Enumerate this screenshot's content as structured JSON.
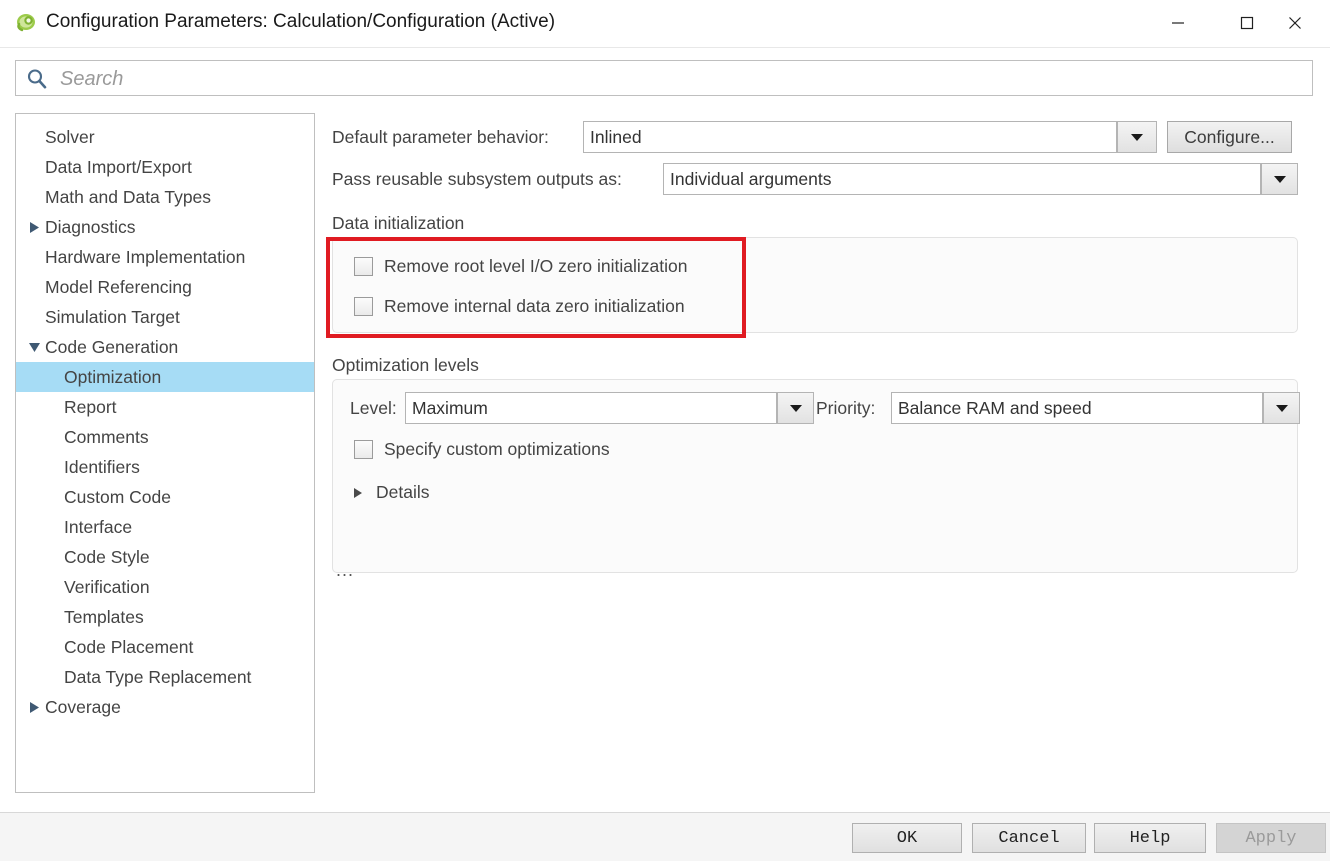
{
  "window": {
    "title": "Configuration Parameters: Calculation/Configuration (Active)",
    "app_icon": "simulink-icon",
    "minimize_label": "–",
    "maximize_label": "□",
    "close_label": "✕"
  },
  "search": {
    "placeholder": "Search",
    "value": "",
    "icon": "search-icon"
  },
  "sidebar": {
    "items": [
      {
        "label": "Solver",
        "depth": 0,
        "expander": "none",
        "selected": false
      },
      {
        "label": "Data Import/Export",
        "depth": 0,
        "expander": "none",
        "selected": false
      },
      {
        "label": "Math and Data Types",
        "depth": 0,
        "expander": "none",
        "selected": false
      },
      {
        "label": "Diagnostics",
        "depth": 0,
        "expander": "collapsed",
        "selected": false
      },
      {
        "label": "Hardware Implementation",
        "depth": 0,
        "expander": "none",
        "selected": false
      },
      {
        "label": "Model Referencing",
        "depth": 0,
        "expander": "none",
        "selected": false
      },
      {
        "label": "Simulation Target",
        "depth": 0,
        "expander": "none",
        "selected": false
      },
      {
        "label": "Code Generation",
        "depth": 0,
        "expander": "expanded",
        "selected": false
      },
      {
        "label": "Optimization",
        "depth": 1,
        "expander": "none",
        "selected": true
      },
      {
        "label": "Report",
        "depth": 1,
        "expander": "none",
        "selected": false
      },
      {
        "label": "Comments",
        "depth": 1,
        "expander": "none",
        "selected": false
      },
      {
        "label": "Identifiers",
        "depth": 1,
        "expander": "none",
        "selected": false
      },
      {
        "label": "Custom Code",
        "depth": 1,
        "expander": "none",
        "selected": false
      },
      {
        "label": "Interface",
        "depth": 1,
        "expander": "none",
        "selected": false
      },
      {
        "label": "Code Style",
        "depth": 1,
        "expander": "none",
        "selected": false
      },
      {
        "label": "Verification",
        "depth": 1,
        "expander": "none",
        "selected": false
      },
      {
        "label": "Templates",
        "depth": 1,
        "expander": "none",
        "selected": false
      },
      {
        "label": "Code Placement",
        "depth": 1,
        "expander": "none",
        "selected": false
      },
      {
        "label": "Data Type Replacement",
        "depth": 1,
        "expander": "none",
        "selected": false
      },
      {
        "label": "Coverage",
        "depth": 0,
        "expander": "collapsed",
        "selected": false
      }
    ]
  },
  "main": {
    "default_parameter_behavior": {
      "label": "Default parameter behavior:",
      "value": "Inlined"
    },
    "configure_button": {
      "label": "Configure..."
    },
    "pass_reusable_subsystem_outputs": {
      "label": "Pass reusable subsystem outputs as:",
      "value": "Individual arguments"
    },
    "data_initialization": {
      "title": "Data initialization",
      "checkboxes": [
        {
          "label": "Remove root level I/O zero initialization",
          "checked": false
        },
        {
          "label": "Remove internal data zero initialization",
          "checked": false
        }
      ],
      "highlight_color": "#e01b22"
    },
    "optimization_levels": {
      "title": "Optimization levels",
      "level": {
        "label": "Level:",
        "value": "Maximum"
      },
      "priority": {
        "label": "Priority:",
        "value": "Balance RAM and speed"
      },
      "specify_custom": {
        "label": "Specify custom optimizations",
        "checked": false
      },
      "details": {
        "label": "Details",
        "expander": "collapsed"
      }
    },
    "overflow_indicator": "..."
  },
  "footer": {
    "buttons": [
      {
        "label": "OK",
        "enabled": true
      },
      {
        "label": "Cancel",
        "enabled": true
      },
      {
        "label": "Help",
        "enabled": true
      },
      {
        "label": "Apply",
        "enabled": false
      }
    ]
  }
}
